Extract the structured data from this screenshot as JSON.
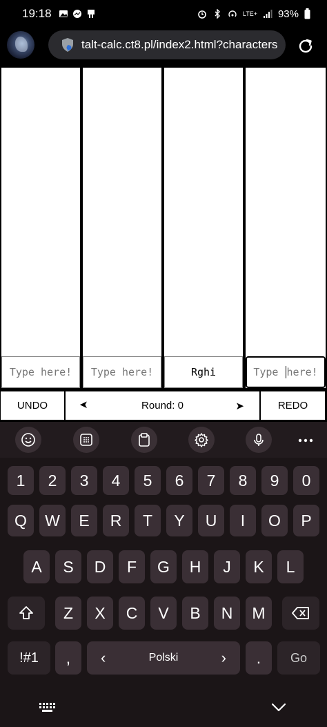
{
  "status": {
    "time": "19:18",
    "battery": "93%",
    "network": "LTE+"
  },
  "browser": {
    "url": "talt-calc.ct8.pl/index2.html?characters"
  },
  "columns": [
    {
      "value": "",
      "placeholder": "Type here!"
    },
    {
      "value": "",
      "placeholder": "Type here!"
    },
    {
      "value": "Rghi",
      "placeholder": "Type here!"
    },
    {
      "value": "",
      "placeholder": "Type here!",
      "focused": true
    }
  ],
  "column4": {
    "text_before": "Type ",
    "text_after": "here!"
  },
  "controls": {
    "undo": "UNDO",
    "redo": "REDO",
    "prev_arrow": "➤",
    "next_arrow": "➤",
    "round_label": "Round: 0"
  },
  "keyboard": {
    "numbers": [
      "1",
      "2",
      "3",
      "4",
      "5",
      "6",
      "7",
      "8",
      "9",
      "0"
    ],
    "row1": [
      "Q",
      "W",
      "E",
      "R",
      "T",
      "Y",
      "U",
      "I",
      "O",
      "P"
    ],
    "row2": [
      "A",
      "S",
      "D",
      "F",
      "G",
      "H",
      "J",
      "K",
      "L"
    ],
    "row3": [
      "Z",
      "X",
      "C",
      "V",
      "B",
      "N",
      "M"
    ],
    "symbols": "!#1",
    "comma": ",",
    "space_lang": "Polski",
    "space_left": "‹",
    "space_right": "›",
    "period": ".",
    "go": "Go"
  }
}
